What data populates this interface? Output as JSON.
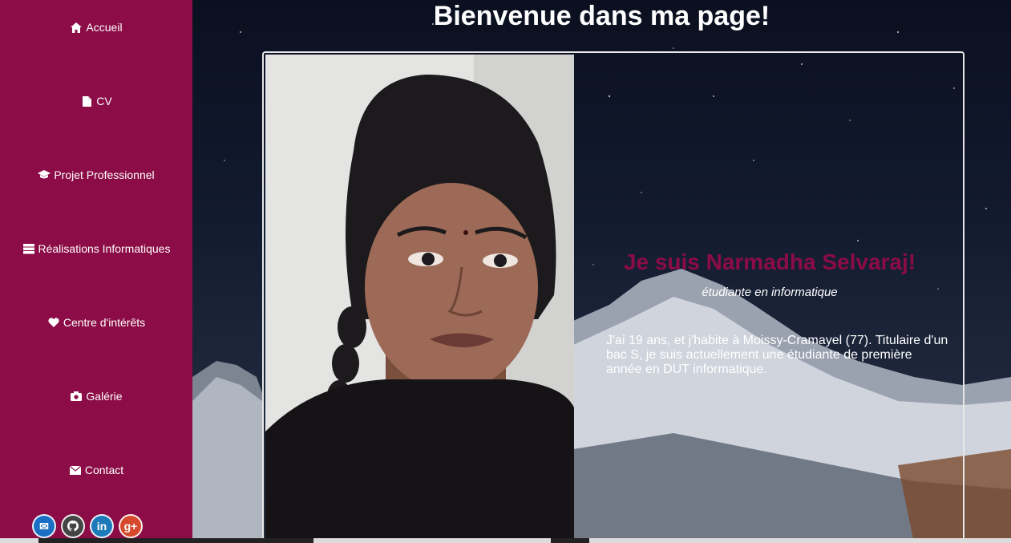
{
  "page": {
    "title": "Bienvenue dans ma page!"
  },
  "sidebar": {
    "items": [
      {
        "label": "Accueil",
        "icon": "home-icon"
      },
      {
        "label": "CV",
        "icon": "file-icon"
      },
      {
        "label": "Projet Professionnel",
        "icon": "graduation-cap-icon"
      },
      {
        "label": "Réalisations Informatiques",
        "icon": "server-icon"
      },
      {
        "label": "Centre d'intérêts",
        "icon": "heart-icon"
      },
      {
        "label": "Galérie",
        "icon": "camera-icon"
      },
      {
        "label": "Contact",
        "icon": "envelope-icon"
      }
    ],
    "socials": [
      {
        "icon": "mail-icon",
        "glyph": "✉",
        "color": "#1a6fc4"
      },
      {
        "icon": "github-icon",
        "glyph": "●",
        "color": "#444444"
      },
      {
        "icon": "linkedin-icon",
        "glyph": "in",
        "color": "#1d7ab8"
      },
      {
        "icon": "google-plus-icon",
        "glyph": "g+",
        "color": "#d6492d"
      }
    ]
  },
  "intro": {
    "name": "Je suis Narmadha Selvaraj!",
    "subtitle": "étudiante en informatique",
    "bio": "J'ai 19 ans, et j'habite à Moissy-Cramayel (77). Titulaire d'un bac S, je suis actuellement une étudiante de première année en DUT informatique."
  },
  "colors": {
    "accent": "#8b0c46",
    "sky": "#0e1424"
  }
}
